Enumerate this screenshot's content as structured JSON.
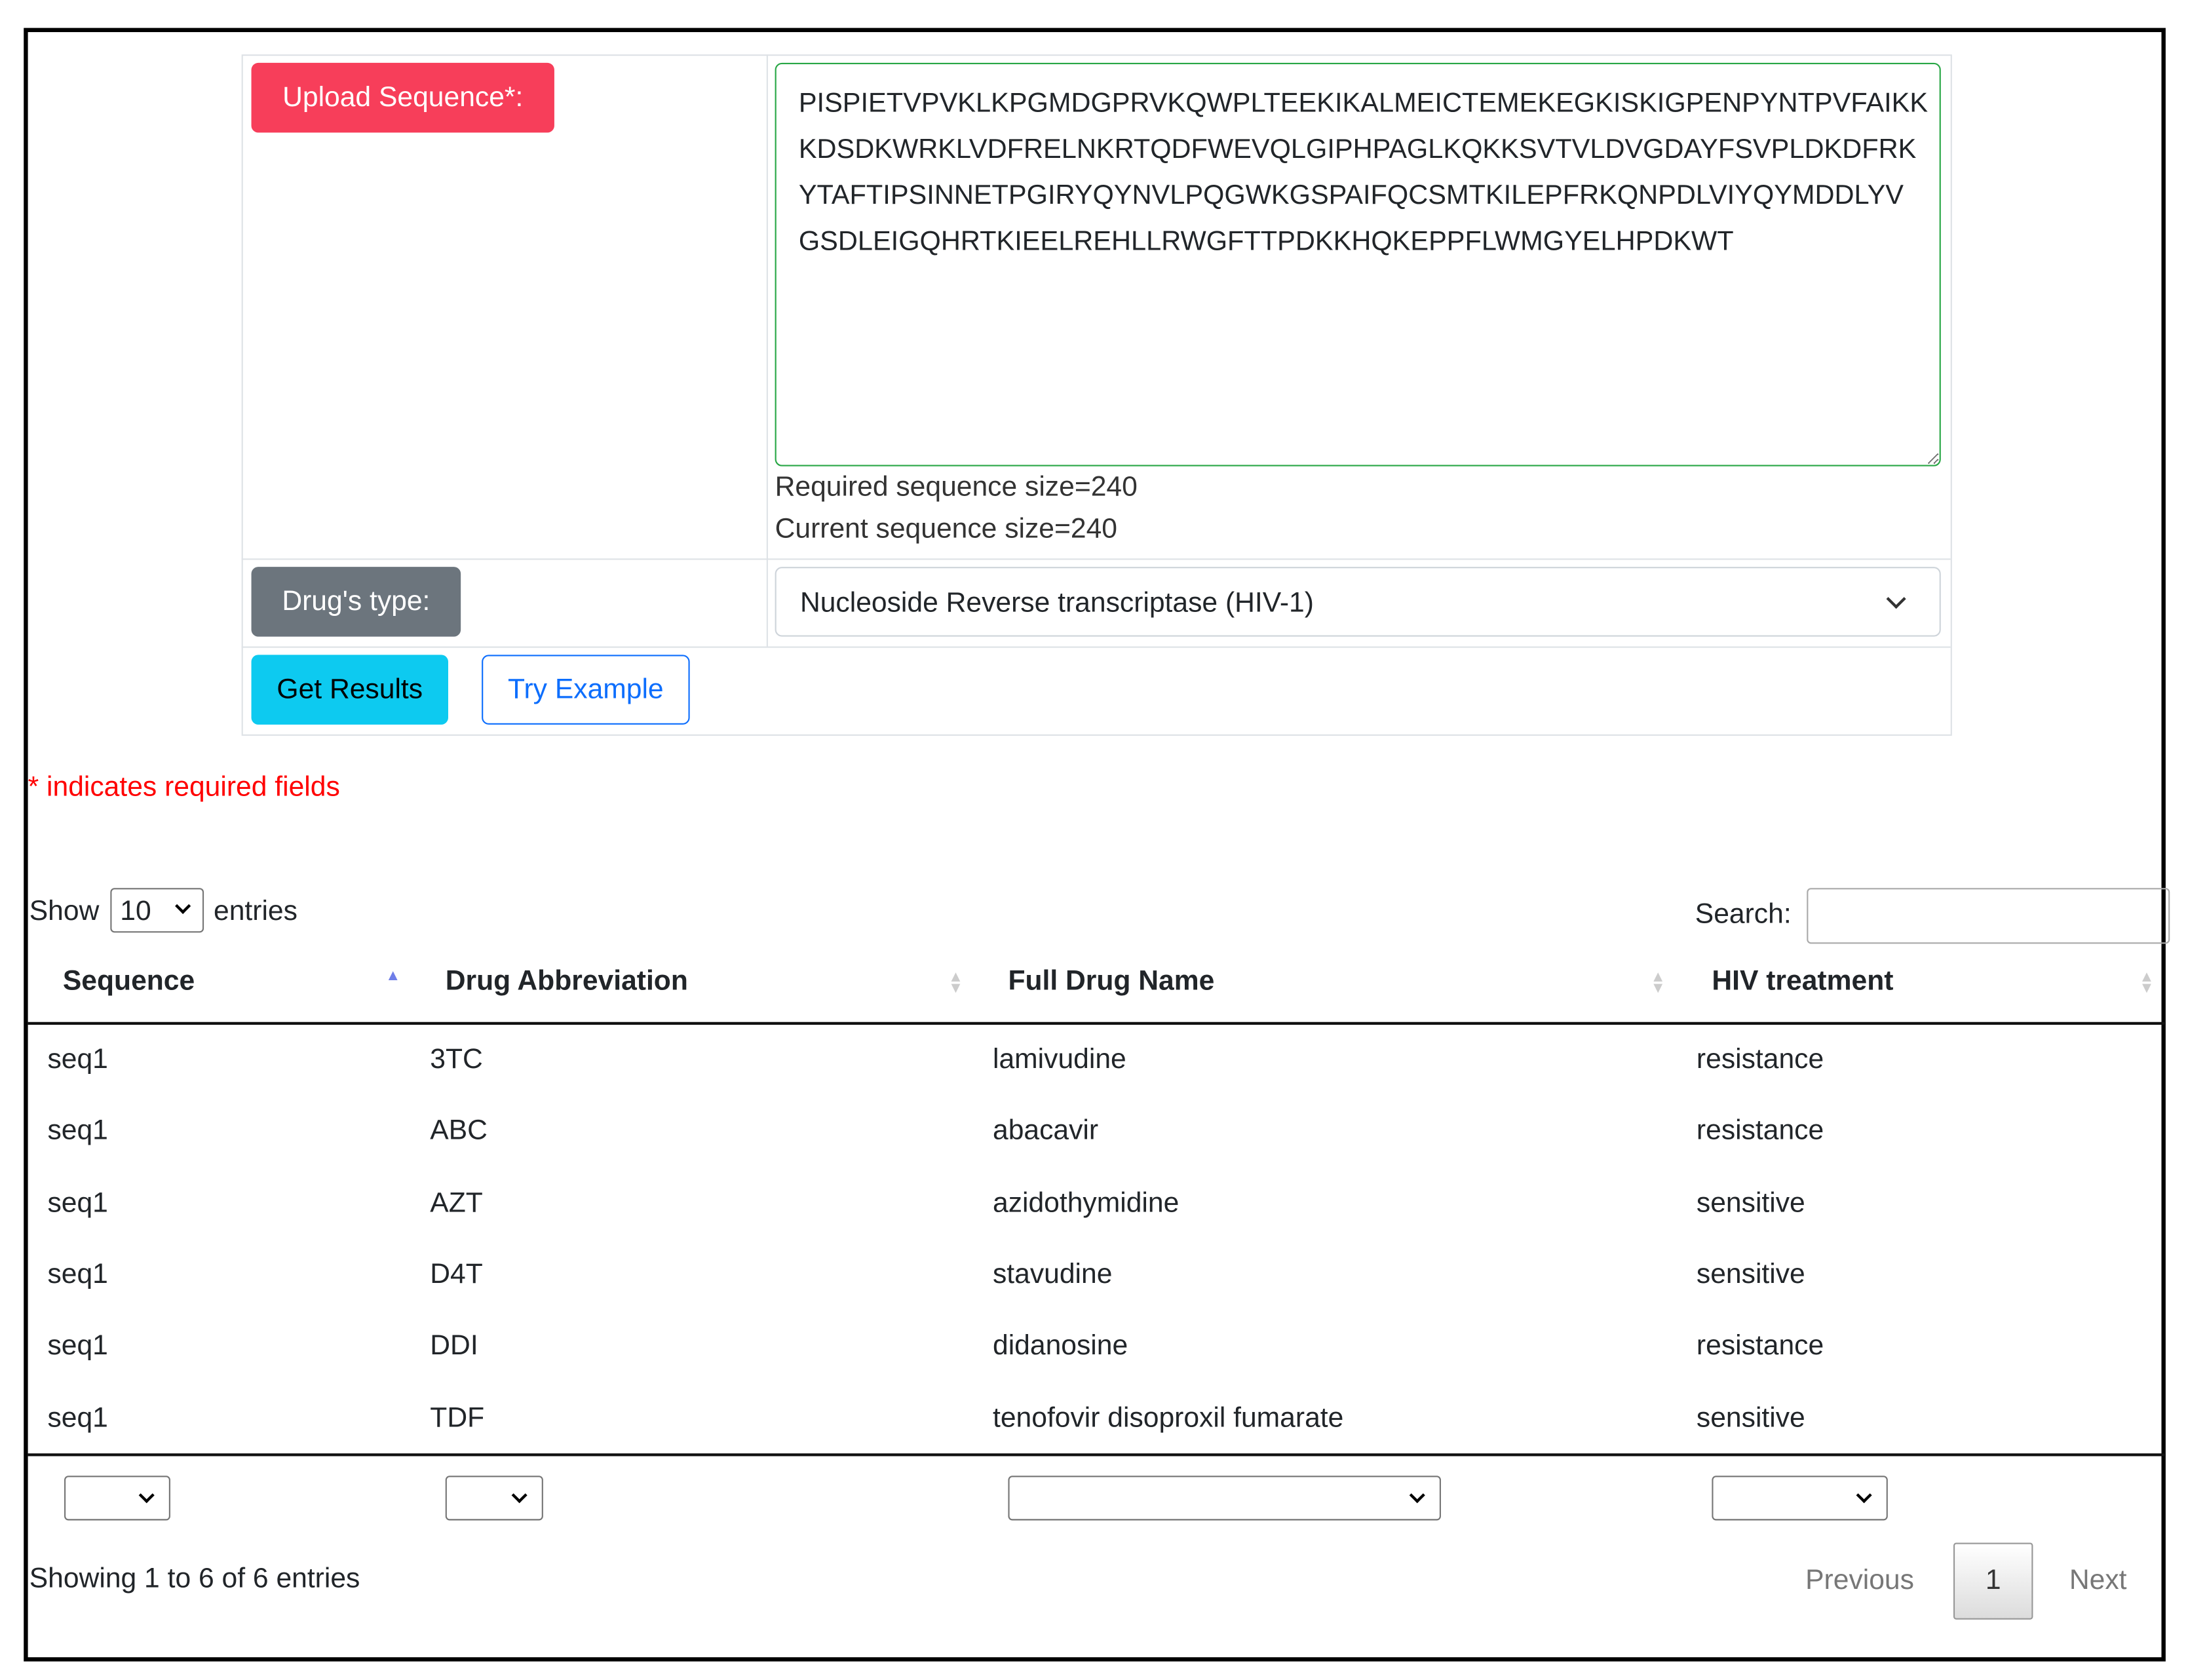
{
  "form": {
    "upload_label": "Upload Sequence*:",
    "sequence_value": "PISPIETVPVKLKPGMDGPRVKQWPLTEEKIKALMEICTEMEKEGKISKIGPENPYNTPVFAIKK\nKDSDKWRKLVDFRELNKRTQDFWEVQLGIPHPAGLKQKKSVTVLDVGDAYFSVPLDKDFRK\nYTAFTIPSINNETPGIRYQYNVLPQGWKGSPAIFQCSMTKILEPFRKQNPDLVIYQYMDDLYV\nGSDLEIGQHRTKIEELREHLLRWGFTTPDKKHQKEPPFLWMGYELHPDKWT",
    "required_size": "Required sequence size=240",
    "current_size": "Current sequence size=240",
    "drug_type_label": "Drug's type:",
    "drug_type_value": "Nucleoside Reverse transcriptase (HIV-1)",
    "get_results": "Get Results",
    "try_example": "Try Example",
    "required_note": "* indicates required fields"
  },
  "table_controls": {
    "show": "Show",
    "page_length": "10",
    "entries": "entries",
    "search_label": "Search:",
    "search_value": ""
  },
  "table": {
    "headers": [
      "Sequence",
      "Drug Abbreviation",
      "Full Drug Name",
      "HIV treatment"
    ],
    "rows": [
      [
        "seq1",
        "3TC",
        "lamivudine",
        "resistance"
      ],
      [
        "seq1",
        "ABC",
        "abacavir",
        "resistance"
      ],
      [
        "seq1",
        "AZT",
        "azidothymidine",
        "sensitive"
      ],
      [
        "seq1",
        "D4T",
        "stavudine",
        "sensitive"
      ],
      [
        "seq1",
        "DDI",
        "didanosine",
        "resistance"
      ],
      [
        "seq1",
        "TDF",
        "tenofovir disoproxil fumarate",
        "sensitive"
      ]
    ]
  },
  "footer": {
    "info": "Showing 1 to 6 of 6 entries",
    "previous": "Previous",
    "page": "1",
    "next": "Next"
  },
  "colors": {
    "upload": "#f73e5a",
    "drug_type": "#6c757d",
    "get_results": "#0dcaf0",
    "try_example": "#0d6efd",
    "required": "#ff0000"
  }
}
